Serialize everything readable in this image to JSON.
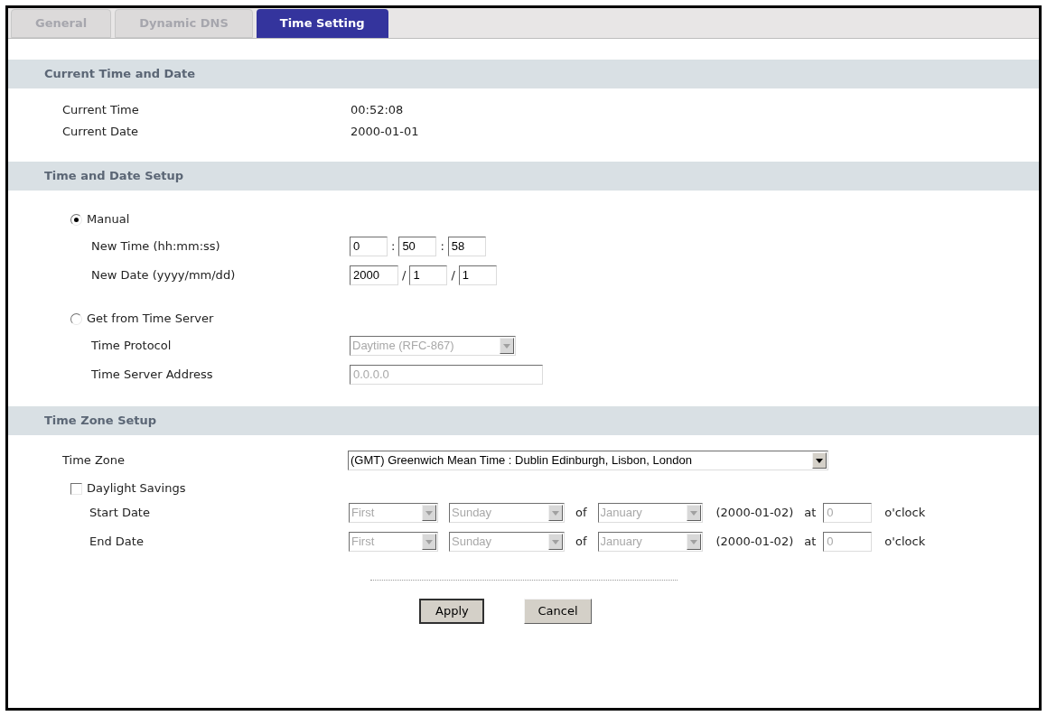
{
  "tabs": [
    {
      "label": "General",
      "selected": false
    },
    {
      "label": "Dynamic DNS",
      "selected": false
    },
    {
      "label": "Time Setting",
      "selected": true
    }
  ],
  "current": {
    "title": "Current Time and Date",
    "rows": [
      {
        "label": "Current Time",
        "value": "00:52:08"
      },
      {
        "label": "Current Date",
        "value": "2000-01-01"
      }
    ]
  },
  "setup": {
    "title": "Time and Date Setup",
    "modes": [
      {
        "label": "Manual",
        "selected": true,
        "fields": [
          {
            "kind": "parts",
            "label": "New Time (hh:mm:ss)",
            "values": [
              "0",
              "50",
              "58"
            ],
            "separators": [
              ":",
              ":"
            ]
          },
          {
            "kind": "parts",
            "label": "New Date (yyyy/mm/dd)",
            "values": [
              "2000",
              "1",
              "1"
            ],
            "separators": [
              "/",
              "/"
            ]
          }
        ]
      },
      {
        "label": "Get from Time Server",
        "selected": false,
        "fields": [
          {
            "kind": "select",
            "label": "Time Protocol",
            "value": "Daytime (RFC-867)",
            "disabled": true
          },
          {
            "kind": "text",
            "label": "Time Server Address",
            "value": "0.0.0.0",
            "disabled": true
          }
        ]
      }
    ]
  },
  "zone": {
    "title": "Time Zone Setup",
    "label": "Time Zone",
    "value": "(GMT) Greenwich Mean Time : Dublin Edinburgh, Lisbon, London",
    "daylight": {
      "label": "Daylight Savings",
      "checked": false
    },
    "rows": [
      {
        "label": "Start Date",
        "order": "First",
        "day": "Sunday",
        "of": "of",
        "month": "January",
        "date": "(2000-01-02)",
        "at": "at",
        "hour": "0",
        "oclock": "o'clock",
        "disabled": true
      },
      {
        "label": "End Date",
        "order": "First",
        "day": "Sunday",
        "of": "of",
        "month": "January",
        "date": "(2000-01-02)",
        "at": "at",
        "hour": "0",
        "oclock": "o'clock",
        "disabled": true
      }
    ]
  },
  "buttons": [
    {
      "label": "Apply",
      "focused": true
    },
    {
      "label": "Cancel",
      "focused": false
    }
  ]
}
